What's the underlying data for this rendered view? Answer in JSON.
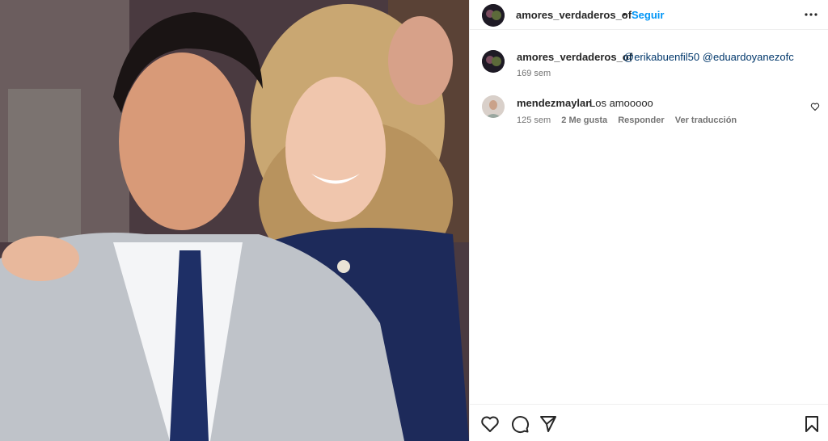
{
  "post": {
    "author": "amores_verdaderos_of",
    "separator": "•",
    "follow_label": "Seguir",
    "more_icon": "more-horizontal-icon"
  },
  "caption": {
    "author": "amores_verdaderos_of",
    "mentions": [
      "@erikabuenfil50",
      "@eduardoyanezofc"
    ],
    "time": "169 sem"
  },
  "comment": {
    "author": "mendezmaylan",
    "text": "Los amooooo",
    "time": "125 sem",
    "likes": "2 Me gusta",
    "reply_label": "Responder",
    "translate_label": "Ver traducción"
  },
  "actions": {
    "icons": [
      "heart-icon",
      "comment-icon",
      "share-icon",
      "bookmark-icon"
    ]
  },
  "colors": {
    "link": "#0095f6",
    "mention": "#00376b",
    "muted": "#737373",
    "text": "#262626"
  }
}
